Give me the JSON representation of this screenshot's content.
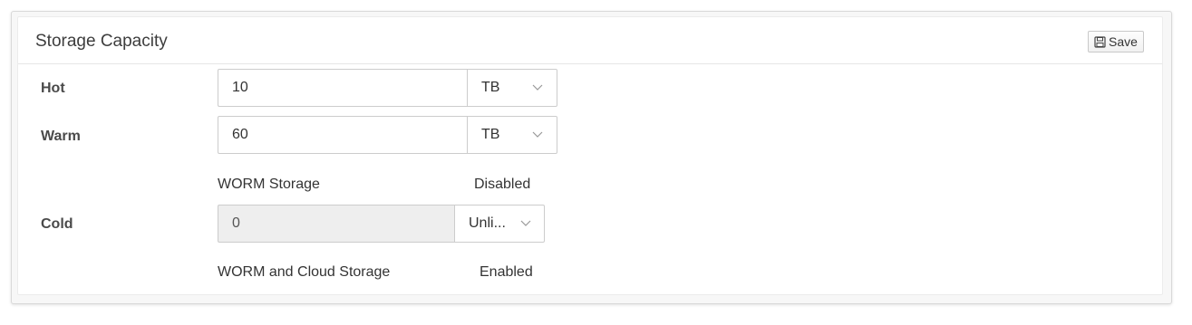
{
  "panel": {
    "title": "Storage Capacity",
    "save_label": "Save"
  },
  "rows": {
    "hot": {
      "label": "Hot",
      "value": "10",
      "unit": "TB"
    },
    "warm": {
      "label": "Warm",
      "value": "60",
      "unit": "TB",
      "info_label": "WORM Storage",
      "info_value": "Disabled"
    },
    "cold": {
      "label": "Cold",
      "value": "0",
      "unit": "Unli...",
      "info_label": "WORM and Cloud Storage",
      "info_value": "Enabled"
    }
  },
  "icons": {
    "save": "floppy-disk-icon",
    "dropdown": "chevron-down-icon"
  }
}
